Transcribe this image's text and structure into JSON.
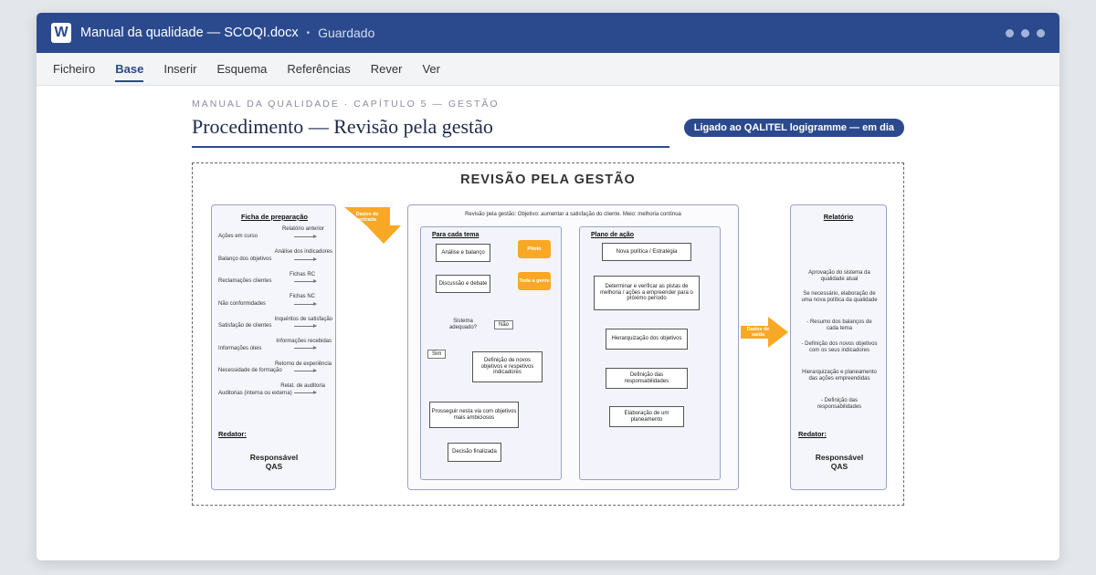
{
  "app": {
    "icon_letter": "W",
    "document_title": "Manual da qualidade — SCOQI.docx",
    "separator": "•",
    "save_status": "Guardado"
  },
  "ribbon": {
    "tabs": [
      {
        "label": "Ficheiro",
        "active": false
      },
      {
        "label": "Base",
        "active": true
      },
      {
        "label": "Inserir",
        "active": false
      },
      {
        "label": "Esquema",
        "active": false
      },
      {
        "label": "Referências",
        "active": false
      },
      {
        "label": "Rever",
        "active": false
      },
      {
        "label": "Ver",
        "active": false
      }
    ]
  },
  "page": {
    "kicker": "MANUAL DA QUALIDADE · CAPÍTULO 5 — GESTÃO",
    "title": "Procedimento — Revisão pela gestão",
    "badge": "Ligado ao QALITEL logigramme — em dia"
  },
  "diagram": {
    "title": "REVISÃO PELA GESTÃO",
    "input_arrow": "Dados de entrada",
    "output_arrow": "Dados de saída",
    "prep": {
      "heading": "Ficha de preparação",
      "rows": [
        {
          "left": "Ações em curso",
          "right": "Relatório anterior"
        },
        {
          "left": "Balanço dos objetivos",
          "right": "Análise dos indicadores"
        },
        {
          "left": "Reclamações clientes",
          "right": "Fichas RC"
        },
        {
          "left": "Não conformidades",
          "right": "Fichas NC"
        },
        {
          "left": "Satisfação de clientes",
          "right": "Inquéritos de satisfação"
        },
        {
          "left": "Informações úteis",
          "right": "Informações recebidas"
        },
        {
          "left": "Necessidade de formação",
          "right": "Retorno de experiência"
        },
        {
          "left": "Auditorias (interna ou externa)",
          "right": "Relat. de auditoria"
        }
      ],
      "redator": "Redator:",
      "responsible": "Responsável QAS"
    },
    "center": {
      "caption": "Revisão pela gestão: Objetivo: aumentar a satisfação do cliente. Meio: melhoria contínua",
      "theme": {
        "heading": "Para cada tema",
        "analysis": "Análise e balanço",
        "pilot": "Piloto",
        "discussion": "Discussão e debate",
        "everyone": "Toda a gente",
        "decision": "Sistema adequado?",
        "no": "Não",
        "yes": "Sim",
        "new_objectives": "Definição de novos objetivos e respetivos indicadores",
        "continue": "Prosseguir nesta via com objetivos mais ambiciosos",
        "final": "Decisão finalizada"
      },
      "action": {
        "heading": "Plano de ação",
        "s1": "Nova política / Estratégia",
        "s2": "Determinar e verificar as pistas de melhoria / ações a empreender para o próximo período",
        "s3": "Hierarquização dos objetivos",
        "s4": "Definição das responsabilidades",
        "s5": "Elaboração de um planeamento"
      }
    },
    "report": {
      "heading": "Relatório",
      "items": [
        "Aprovação do sistema da qualidade atual",
        "Se necessário, elaboração de uma nova política da qualidade",
        "- Resumo dos balanços de cada tema",
        "- Definição dos novos objetivos com os seus indicadores",
        "Hierarquização e planeamento das ações empreendidas",
        "- Definição das responsabilidades"
      ],
      "redator": "Redator:",
      "responsible": "Responsável QAS"
    }
  },
  "colors": {
    "brand": "#2b4a8e",
    "accent_orange": "#f9a825",
    "panel_border": "#9aa3c8"
  }
}
